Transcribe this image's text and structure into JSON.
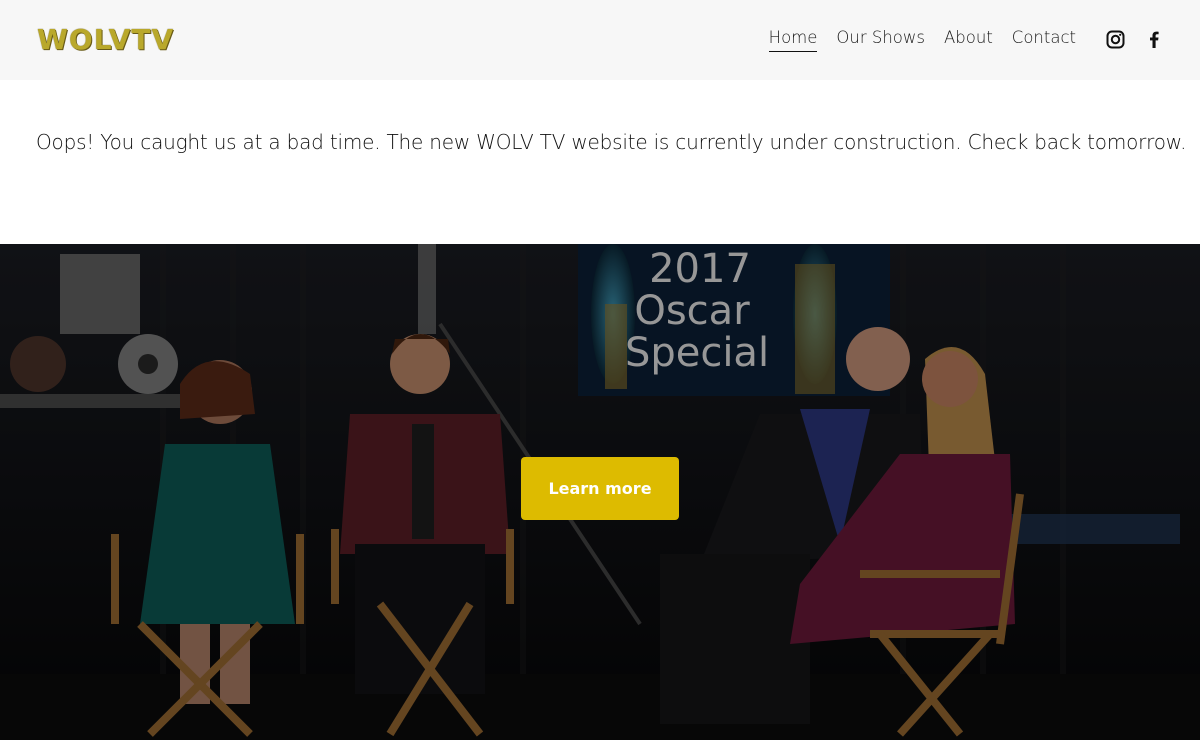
{
  "brand": {
    "logo_text": "WOLVTV",
    "accent": "#ddbb00"
  },
  "nav": {
    "items": [
      {
        "label": "Home",
        "active": true
      },
      {
        "label": "Our Shows",
        "active": false
      },
      {
        "label": "About",
        "active": false
      },
      {
        "label": "Contact",
        "active": false
      }
    ]
  },
  "social": {
    "icons": [
      "instagram-icon",
      "facebook-icon"
    ]
  },
  "notice": {
    "text": "Oops! You caught us at a bad time. The new WOLV TV website is currently under construction. Check back tomorrow."
  },
  "hero": {
    "sign_lines": [
      "2017",
      "Oscar",
      "Special"
    ],
    "cta_label": "Learn more"
  }
}
